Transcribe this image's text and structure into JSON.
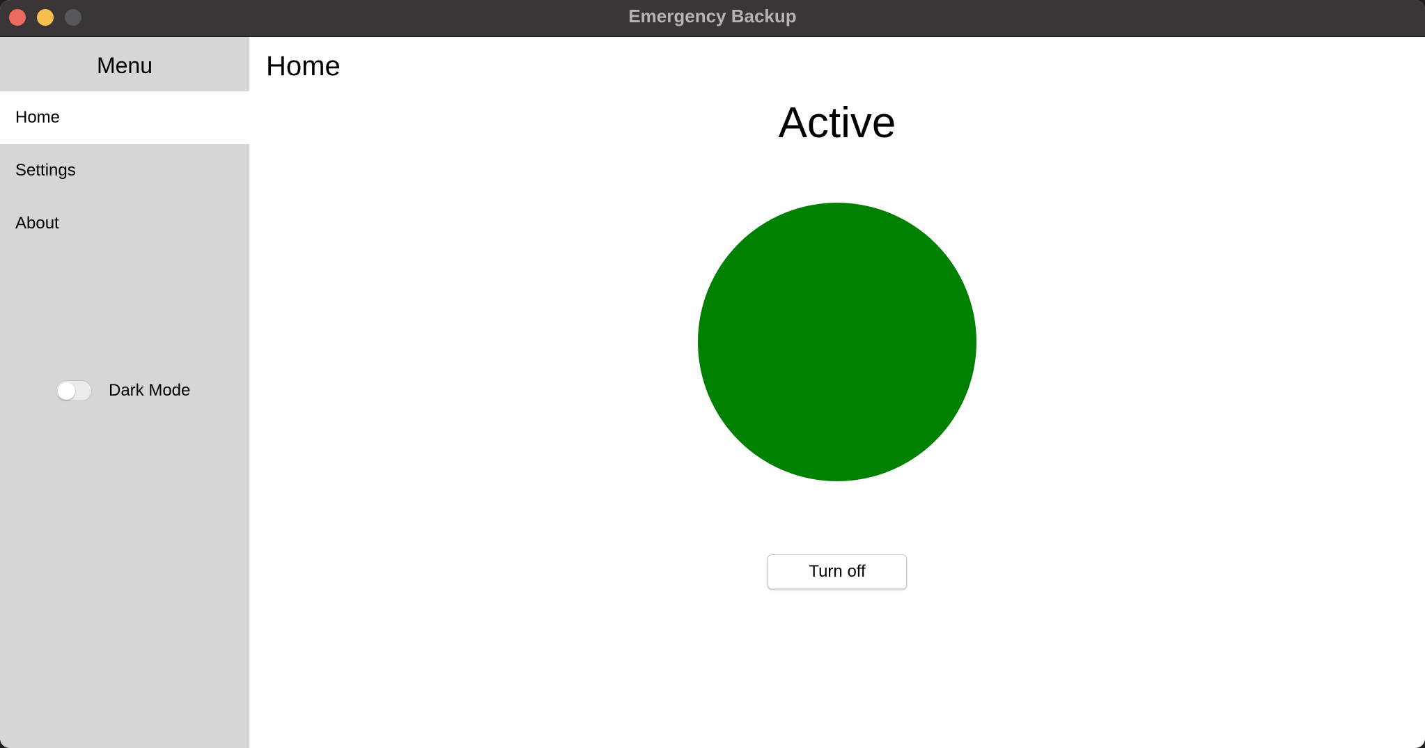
{
  "window": {
    "title": "Emergency Backup"
  },
  "sidebar": {
    "header": "Menu",
    "items": [
      {
        "label": "Home",
        "active": true
      },
      {
        "label": "Settings",
        "active": false
      },
      {
        "label": "About",
        "active": false
      }
    ],
    "dark_mode": {
      "label": "Dark Mode",
      "enabled": false
    }
  },
  "main": {
    "page_title": "Home",
    "status_text": "Active",
    "status_color": "#008000",
    "action_button_label": "Turn off"
  },
  "colors": {
    "titlebar": "#3a3536",
    "sidebar_bg": "#d6d6d6",
    "active_item_bg": "#ffffff",
    "close": "#ed6a5e",
    "minimize": "#f5bf4f",
    "zoom_disabled": "#58565a"
  }
}
